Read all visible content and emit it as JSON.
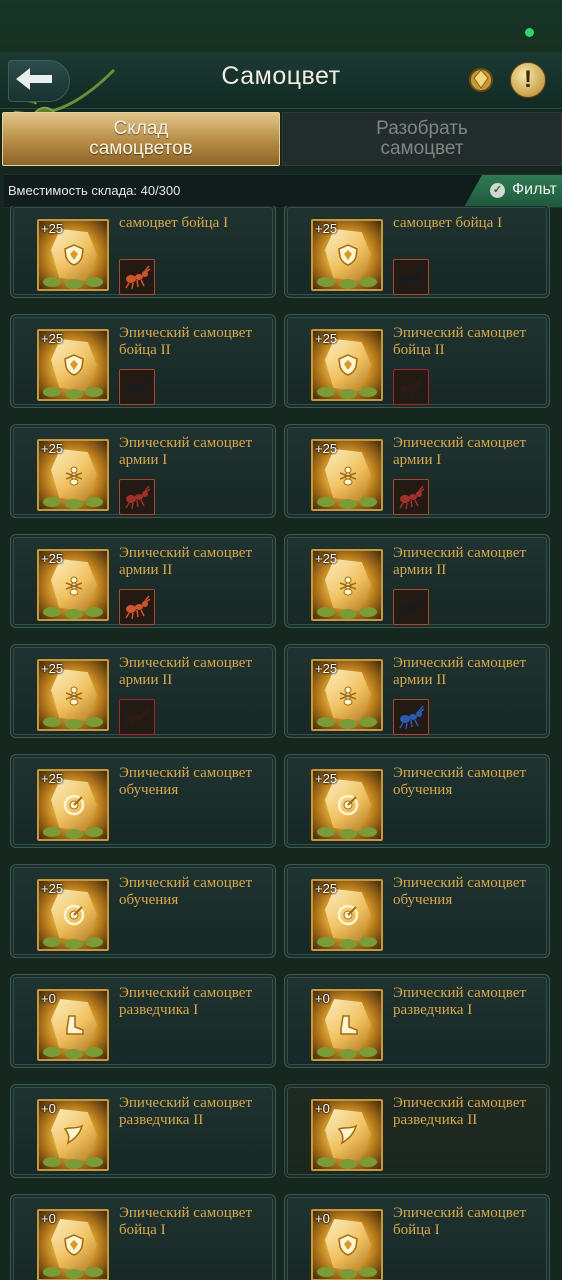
{
  "header": {
    "title": "Самоцвет"
  },
  "tabs": [
    {
      "label": "Склад самоцветов",
      "active": true
    },
    {
      "label": "Разобрать самоцвет",
      "active": false
    }
  ],
  "capacity": {
    "text": "Вместимость склада: 40/300"
  },
  "filter": {
    "label": "Фильт"
  },
  "colors": {
    "accent_gold": "#c7973b",
    "name_text": "#d9a84c",
    "filter_green": "#2f7a54"
  },
  "gems": [
    {
      "name": "самоцвет бойца I",
      "level": "+25",
      "glyph": "shield",
      "unit": "ant-red"
    },
    {
      "name": "самоцвет бойца I",
      "level": "+25",
      "glyph": "shield",
      "unit": "beetle-black"
    },
    {
      "name": "Эпический самоцвет бойца II",
      "level": "+25",
      "glyph": "shield",
      "unit": "beetle-black"
    },
    {
      "name": "Эпический самоцвет бойца II",
      "level": "+25",
      "glyph": "shield",
      "unit": "spider-black"
    },
    {
      "name": "Эпический самоцвет армии I",
      "level": "+25",
      "glyph": "ant",
      "unit": "beetle-red"
    },
    {
      "name": "Эпический самоцвет армии I",
      "level": "+25",
      "glyph": "ant",
      "unit": "beetle-red"
    },
    {
      "name": "Эпический самоцвет армии II",
      "level": "+25",
      "glyph": "ant",
      "unit": "ant-red"
    },
    {
      "name": "Эпический самоцвет армии II",
      "level": "+25",
      "glyph": "ant",
      "unit": "beetle-black"
    },
    {
      "name": "Эпический самоцвет армии II",
      "level": "+25",
      "glyph": "ant",
      "unit": "spider-black"
    },
    {
      "name": "Эпический самоцвет армии II",
      "level": "+25",
      "glyph": "ant",
      "unit": "beetle-blue"
    },
    {
      "name": "Эпический самоцвет обучения",
      "level": "+25",
      "glyph": "target",
      "unit": ""
    },
    {
      "name": "Эпический самоцвет обучения",
      "level": "+25",
      "glyph": "target",
      "unit": ""
    },
    {
      "name": "Эпический самоцвет обучения",
      "level": "+25",
      "glyph": "target",
      "unit": ""
    },
    {
      "name": "Эпический самоцвет обучения",
      "level": "+25",
      "glyph": "target",
      "unit": ""
    },
    {
      "name": "Эпический самоцвет разведчика I",
      "level": "+0",
      "glyph": "boot",
      "unit": ""
    },
    {
      "name": "Эпический самоцвет разведчика I",
      "level": "+0",
      "glyph": "boot",
      "unit": ""
    },
    {
      "name": "Эпический самоцвет разведчика II",
      "level": "+0",
      "glyph": "wing",
      "unit": ""
    },
    {
      "name": "Эпический самоцвет разведчика II",
      "level": "+0",
      "glyph": "wing",
      "unit": ""
    },
    {
      "name": "Эпический самоцвет бойца I",
      "level": "+0",
      "glyph": "shield",
      "unit": ""
    },
    {
      "name": "Эпический самоцвет бойца I",
      "level": "+0",
      "glyph": "shield",
      "unit": ""
    }
  ]
}
